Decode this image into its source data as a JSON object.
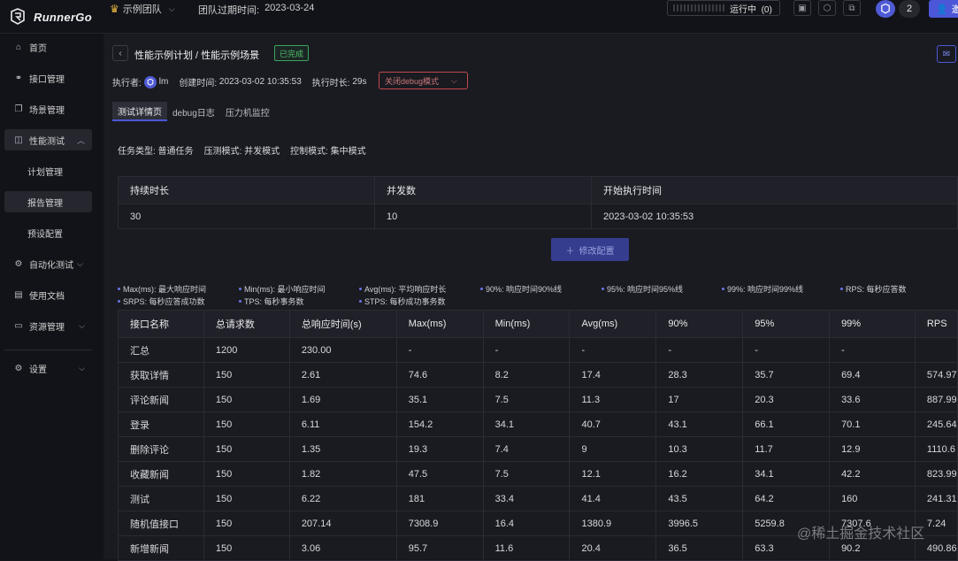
{
  "app": {
    "name": "RunnerGo"
  },
  "topbar": {
    "team_name": "示例团队",
    "expire_label": "团队过期时间:",
    "expire_date": "2023-03-24",
    "running_label": "运行中",
    "running_count": "(0)",
    "member_count": "2",
    "invite_label": "邀"
  },
  "sidebar": {
    "items": [
      {
        "label": "首页",
        "icon": "home-icon"
      },
      {
        "label": "接口管理",
        "icon": "link-icon"
      },
      {
        "label": "场景管理",
        "icon": "scene-icon"
      },
      {
        "label": "性能测试",
        "icon": "chart-icon"
      },
      {
        "label": "自动化测试",
        "icon": "auto-icon"
      },
      {
        "label": "使用文档",
        "icon": "doc-icon"
      },
      {
        "label": "资源管理",
        "icon": "resource-icon"
      },
      {
        "label": "设置",
        "icon": "gear-icon"
      }
    ],
    "subitems": [
      "计划管理",
      "报告管理",
      "预设配置"
    ]
  },
  "header": {
    "breadcrumb": "性能示例计划 / 性能示例场景",
    "status": "已完成",
    "executor_label": "执行者:",
    "executor_name": "lm",
    "created_label": "创建时间:",
    "created_time": "2023-03-02 10:35:53",
    "duration_label": "执行时长:",
    "duration_value": "29s",
    "debug_select": "关闭debug模式"
  },
  "tabs": [
    "测试详情页",
    "debug日志",
    "压力机监控"
  ],
  "task_info": {
    "task_type": "任务类型: 普通任务",
    "mode": "压测模式: 并发模式",
    "control": "控制模式: 集中模式"
  },
  "config_table": {
    "headers": [
      "持续时长",
      "并发数",
      "开始执行时间"
    ],
    "row": [
      "30",
      "10",
      "2023-03-02 10:35:53"
    ]
  },
  "edit_button": "修改配置",
  "legend": [
    "Max(ms): 最大响应时间",
    "Min(ms): 最小响应时间",
    "Avg(ms): 平均响应时长",
    "90%: 响应时间90%线",
    "95%: 响应时间95%线",
    "99%: 响应时间99%线",
    "RPS: 每秒应答数",
    "SRPS: 每秒应答成功数",
    "TPS: 每秒事务数",
    "STPS: 每秒成功事务数"
  ],
  "results": {
    "headers": [
      "接口名称",
      "总请求数",
      "总响应时间(s)",
      "Max(ms)",
      "Min(ms)",
      "Avg(ms)",
      "90%",
      "95%",
      "99%",
      "RPS"
    ],
    "rows": [
      [
        "汇总",
        "1200",
        "230.00",
        "-",
        "-",
        "-",
        "-",
        "-",
        "-",
        ""
      ],
      [
        "获取详情",
        "150",
        "2.61",
        "74.6",
        "8.2",
        "17.4",
        "28.3",
        "35.7",
        "69.4",
        "574.97"
      ],
      [
        "评论新闻",
        "150",
        "1.69",
        "35.1",
        "7.5",
        "11.3",
        "17",
        "20.3",
        "33.6",
        "887.99"
      ],
      [
        "登录",
        "150",
        "6.11",
        "154.2",
        "34.1",
        "40.7",
        "43.1",
        "66.1",
        "70.1",
        "245.64"
      ],
      [
        "删除评论",
        "150",
        "1.35",
        "19.3",
        "7.4",
        "9",
        "10.3",
        "11.7",
        "12.9",
        "1110.6"
      ],
      [
        "收藏新闻",
        "150",
        "1.82",
        "47.5",
        "7.5",
        "12.1",
        "16.2",
        "34.1",
        "42.2",
        "823.99"
      ],
      [
        "测试",
        "150",
        "6.22",
        "181",
        "33.4",
        "41.4",
        "43.5",
        "64.2",
        "160",
        "241.31"
      ],
      [
        "随机值接口",
        "150",
        "207.14",
        "7308.9",
        "16.4",
        "1380.9",
        "3996.5",
        "5259.8",
        "7307.6",
        "7.24"
      ],
      [
        "新增新闻",
        "150",
        "3.06",
        "95.7",
        "11.6",
        "20.4",
        "36.5",
        "63.3",
        "90.2",
        "490.86"
      ]
    ]
  },
  "watermark": "@稀土掘金技术社区"
}
